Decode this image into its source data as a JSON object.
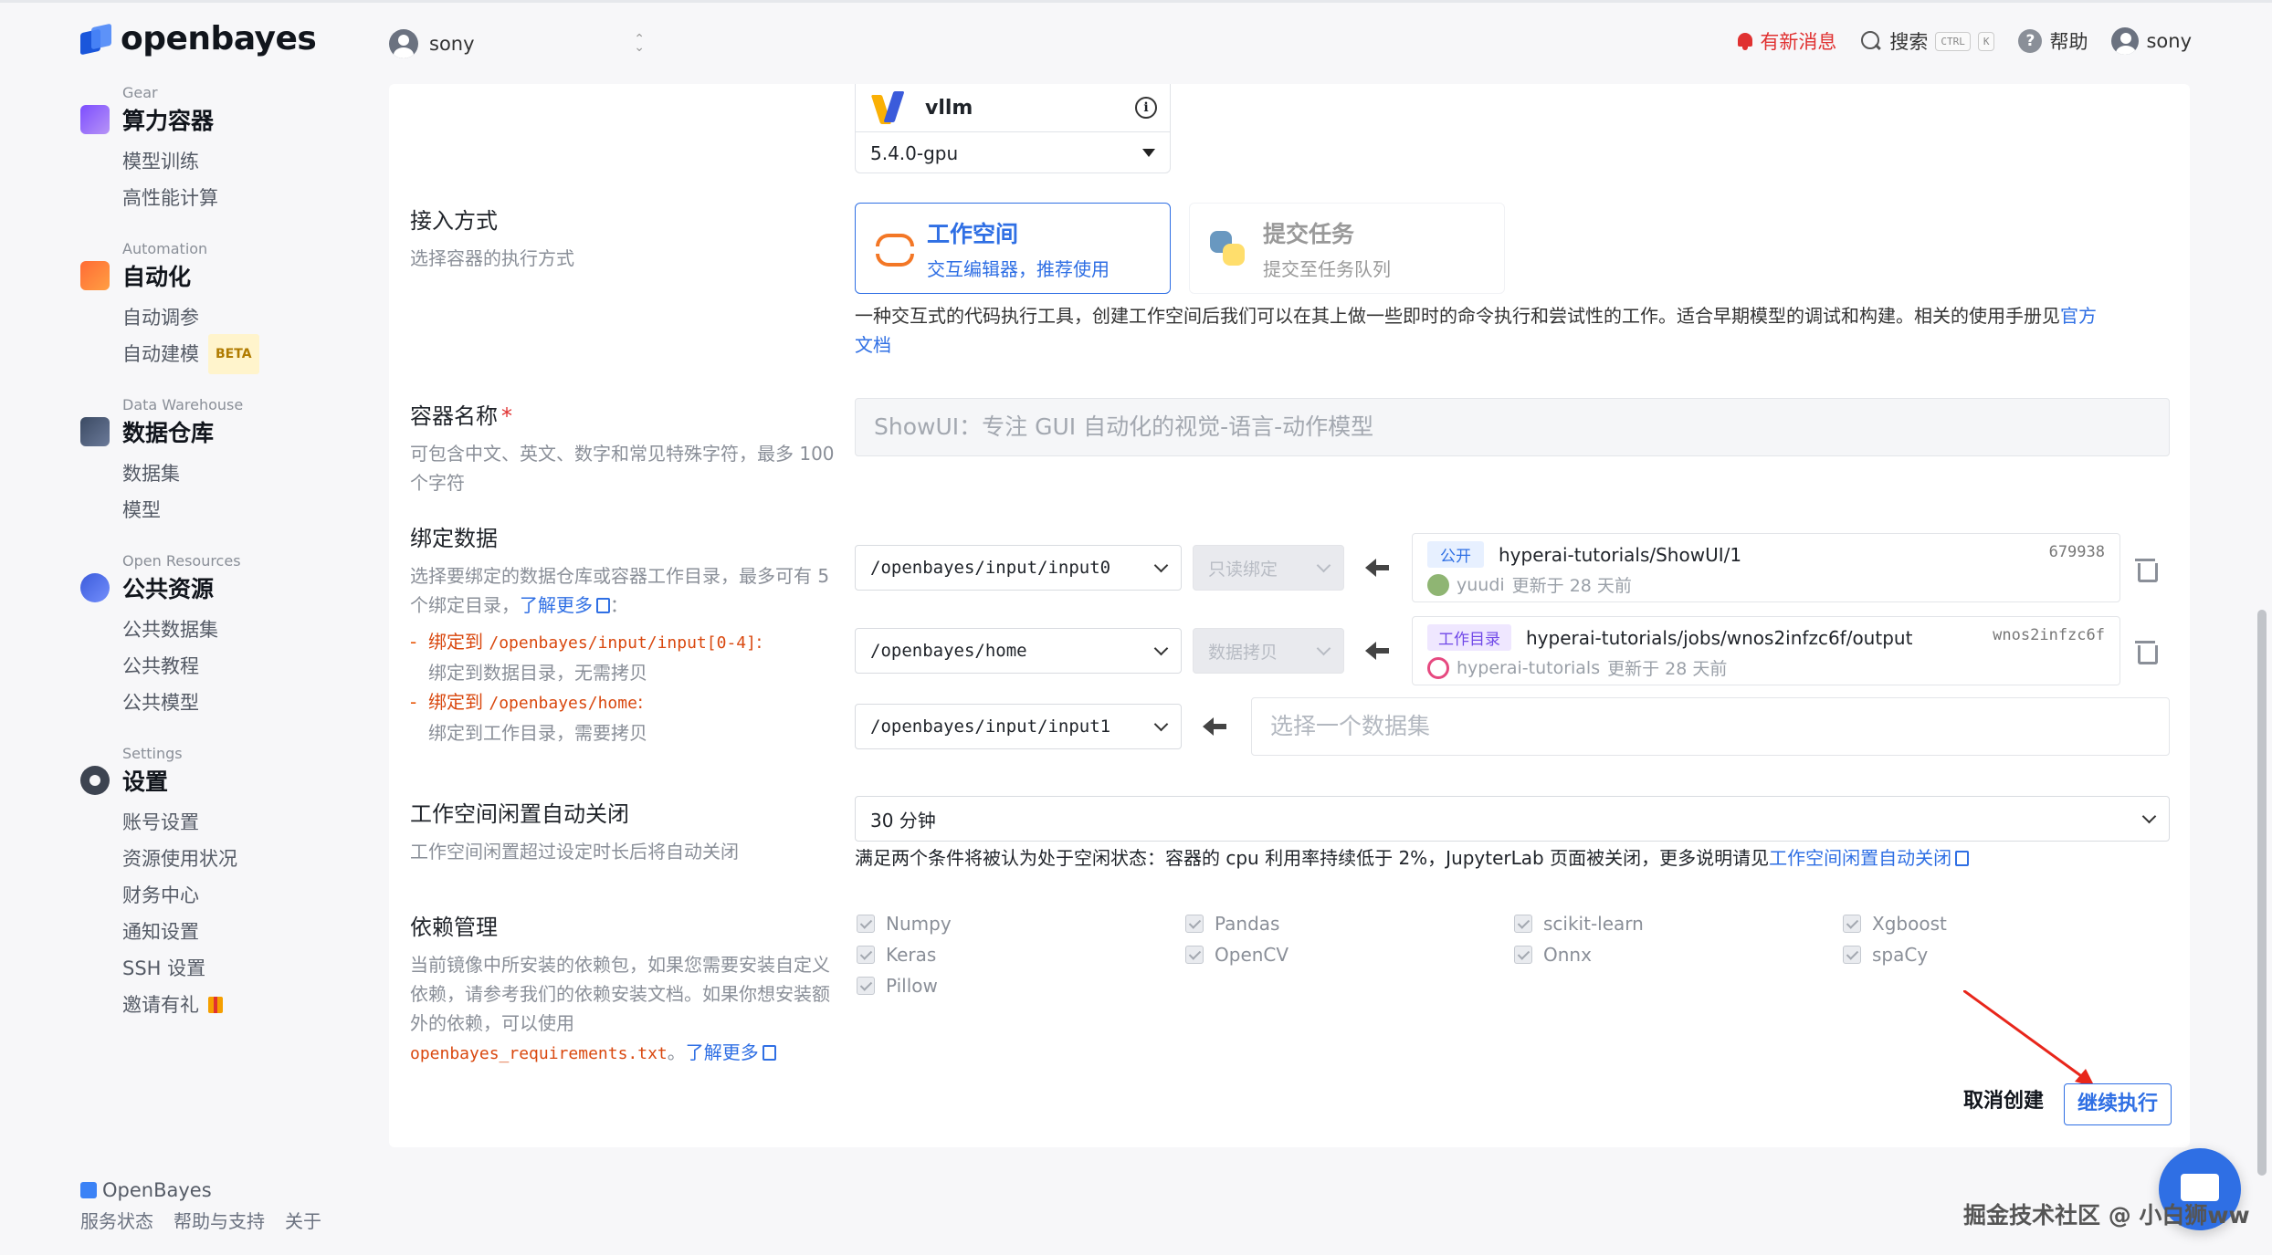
{
  "app": {
    "brand": "openbayes",
    "user": "sony"
  },
  "topbar": {
    "notify": "有新消息",
    "search": "搜索",
    "kbd1": "CTRL",
    "kbd2": "K",
    "help": "帮助",
    "user": "sony"
  },
  "sidebar": {
    "gear": {
      "en": "Gear",
      "title": "算力容器",
      "items": [
        "模型训练",
        "高性能计算"
      ]
    },
    "automation": {
      "en": "Automation",
      "title": "自动化",
      "items": [
        "自动调参",
        "自动建模"
      ],
      "beta": "BETA"
    },
    "warehouse": {
      "en": "Data Warehouse",
      "title": "数据仓库",
      "items": [
        "数据集",
        "模型"
      ]
    },
    "open": {
      "en": "Open Resources",
      "title": "公共资源",
      "items": [
        "公共数据集",
        "公共教程",
        "公共模型"
      ]
    },
    "settings": {
      "en": "Settings",
      "title": "设置",
      "items": [
        "账号设置",
        "资源使用状况",
        "财务中心",
        "通知设置",
        "SSH 设置",
        "邀请有礼"
      ]
    },
    "footer": {
      "brand": "OpenBayes",
      "links": [
        "服务状态",
        "帮助与支持",
        "关于"
      ]
    }
  },
  "image": {
    "name": "vllm",
    "version": "5.4.0-gpu"
  },
  "access": {
    "label": "接入方式",
    "desc": "选择容器的执行方式",
    "workspace": {
      "title": "工作空间",
      "sub": "交互编辑器，推荐使用"
    },
    "task": {
      "title": "提交任务",
      "sub": "提交至任务队列"
    },
    "note": "一种交互式的代码执行工具，创建工作空间后我们可以在其上做一些即时的命令执行和尝试性的工作。适合早期模型的调试和构建。相关的使用手册见",
    "note_link1": "官方",
    "note_link2": "文档"
  },
  "container_name": {
    "label": "容器名称",
    "required": "*",
    "desc": "可包含中文、英文、数字和常见特殊字符，最多 100 个字符",
    "value": "ShowUI：专注 GUI 自动化的视觉-语言-动作模型"
  },
  "bind": {
    "label": "绑定数据",
    "desc": "选择要绑定的数据仓库或容器工作目录，最多可有 5 个绑定目录，",
    "more": "了解更多",
    "colon": "：",
    "rule1_prefix": "绑定到",
    "rule1_path": "/openbayes/input/input[0-4]",
    "rule1_desc": "绑定到数据目录，无需拷贝",
    "rule2_prefix": "绑定到",
    "rule2_path": "/openbayes/home",
    "rule2_desc": "绑定到工作目录，需要拷贝",
    "rows": [
      {
        "path": "/openbayes/input/input0",
        "mode": "只读绑定",
        "tag": "公开",
        "name": "hyperai-tutorials/ShowUI/1",
        "id": "679938",
        "owner": "yuudi",
        "updated": "更新于 28 天前"
      },
      {
        "path": "/openbayes/home",
        "mode": "数据拷贝",
        "tag": "工作目录",
        "name": "hyperai-tutorials/jobs/wnos2infzc6f/output",
        "id": "wnos2infzc6f",
        "owner": "hyperai-tutorials",
        "updated": "更新于 28 天前"
      },
      {
        "path": "/openbayes/input/input1",
        "placeholder": "选择一个数据集"
      }
    ]
  },
  "idle": {
    "label": "工作空间闲置自动关闭",
    "desc": "工作空间闲置超过设定时长后将自动关闭",
    "value": "30 分钟",
    "note": "满足两个条件将被认为处于空闲状态：容器的 cpu 利用率持续低于 2%，JupyterLab 页面被关闭，更多说明请见",
    "note_link": "工作空间闲置自动关闭"
  },
  "deps": {
    "label": "依赖管理",
    "desc": "当前镜像中所安装的依赖包，如果您需要安装自定义依赖，请参考我们的依赖安装文档。如果你想安装额外的依赖，可以使用",
    "file": "openbayes_requirements.txt",
    "period": "。",
    "more": "了解更多",
    "items": [
      "Numpy",
      "Pandas",
      "scikit-learn",
      "Xgboost",
      "Keras",
      "OpenCV",
      "Onnx",
      "spaCy",
      "Pillow"
    ]
  },
  "actions": {
    "cancel": "取消创建",
    "continue": "继续执行"
  },
  "watermark": "掘金技术社区 @ 小白狮ww",
  "icons": [
    "bell-icon",
    "search-icon",
    "help-icon",
    "info-icon",
    "chevron-down-icon",
    "arrow-left-icon",
    "trash-icon",
    "checkbox-icon",
    "doc-icon",
    "chat-icon"
  ]
}
